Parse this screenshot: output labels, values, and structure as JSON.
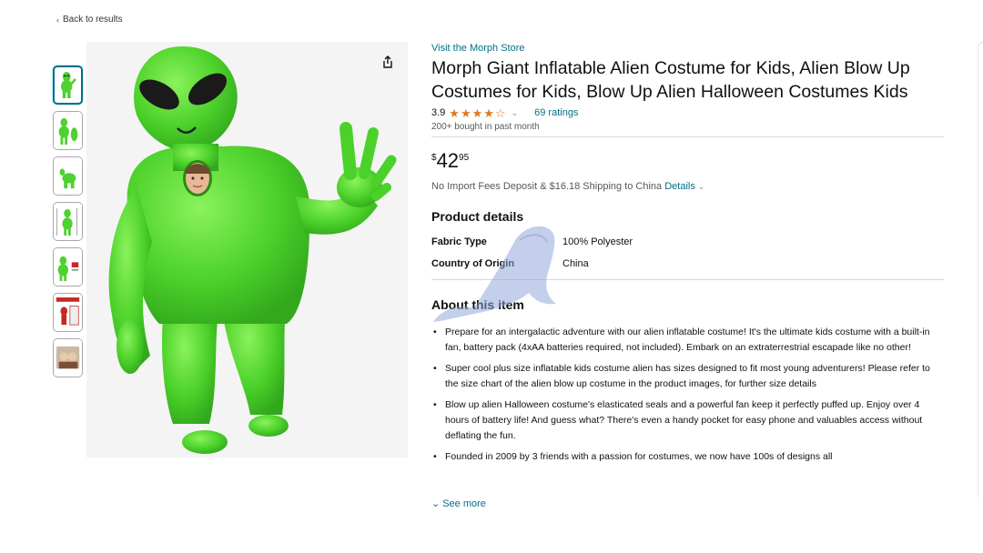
{
  "nav": {
    "back_label": "Back to results"
  },
  "gallery": {
    "thumbnails": [
      {
        "name": "alien-front-view"
      },
      {
        "name": "alien-back-view"
      },
      {
        "name": "alien-crouch-view"
      },
      {
        "name": "alien-size-chart"
      },
      {
        "name": "alien-fan-detail"
      },
      {
        "name": "alien-package"
      },
      {
        "name": "alien-lifestyle"
      }
    ],
    "share_icon": "share-icon"
  },
  "product": {
    "store_link": "Visit the Morph Store",
    "title": "Morph Giant Inflatable Alien Costume for Kids, Alien Blow Up Costumes for Kids, Blow Up Alien Halloween Costumes Kids",
    "rating_value": "3.9",
    "rating_stars": 3.9,
    "ratings_count": "69 ratings",
    "bought_text": "200+ bought in past month",
    "price": {
      "symbol": "$",
      "whole": "42",
      "fraction": "95"
    },
    "shipping_text": "No Import Fees Deposit & $16.18 Shipping to China",
    "shipping_details_link": "Details",
    "accent_color": "#007185",
    "star_color": "#de7921"
  },
  "product_details": {
    "heading": "Product details",
    "rows": [
      {
        "key": "Fabric Type",
        "value": "100% Polyester"
      },
      {
        "key": "Country of Origin",
        "value": "China"
      }
    ]
  },
  "about": {
    "heading": "About this item",
    "bullets": [
      "Prepare for an intergalactic adventure with our alien inflatable costume! It's the ultimate kids costume with a built-in fan, battery pack (4xAA batteries required, not included). Embark on an extraterrestrial escapade like no other!",
      "Super cool plus size inflatable kids costume alien has sizes designed to fit most young adventurers! Please refer to the size chart of the alien blow up costume in the product images, for further size details",
      "Blow up alien Halloween costume's elasticated seals and a powerful fan keep it perfectly puffed up. Enjoy over 4 hours of battery life! And guess what? There's even a handy pocket for easy phone and valuables access without deflating the fun.",
      "Founded in 2009 by 3 friends with a passion for costumes, we now have 100s of designs all"
    ],
    "see_more_label": "See more"
  }
}
